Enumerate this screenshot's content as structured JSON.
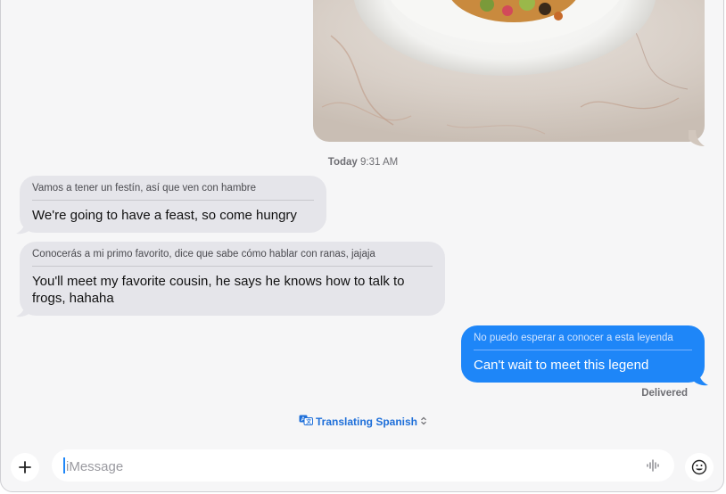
{
  "conversation": {
    "timestamp_day": "Today",
    "timestamp_time": "9:31 AM",
    "messages": [
      {
        "direction": "incoming",
        "original": "Vamos a tener un festín, así que ven con hambre",
        "translation": "We're going to have a feast, so come hungry"
      },
      {
        "direction": "incoming",
        "original": "Conocerás a mi primo favorito, dice que sabe cómo hablar con ranas, jajaja",
        "translation": "You'll meet my favorite cousin, he says he knows how to talk to frogs, hahaha"
      },
      {
        "direction": "outgoing",
        "original": "No puedo esperar a conocer a esta leyenda",
        "translation": "Can't wait to meet this legend"
      }
    ],
    "delivery_status": "Delivered"
  },
  "translation_banner": {
    "label": "Translating Spanish",
    "icon": "translate-icon",
    "chevron": "up-down-chevron-icon"
  },
  "composer": {
    "placeholder": "iMessage",
    "value": "",
    "add_icon": "plus-icon",
    "audio_icon": "waveform-icon",
    "emoji_icon": "emoji-icon"
  },
  "colors": {
    "incoming_bubble": "#e5e5ea",
    "outgoing_bubble": "#1e86f8",
    "accent": "#1e6fd9"
  }
}
